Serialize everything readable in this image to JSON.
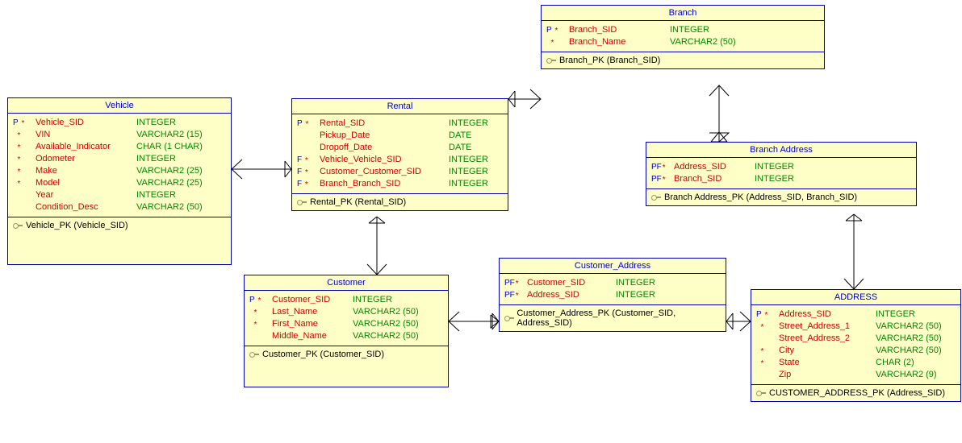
{
  "entities": {
    "vehicle": {
      "title": "Vehicle",
      "columns": [
        {
          "flags": "P*",
          "name": "Vehicle_SID",
          "type": "INTEGER"
        },
        {
          "flags": "*",
          "name": "VIN",
          "type": "VARCHAR2 (15)"
        },
        {
          "flags": "*",
          "name": "Available_Indicator",
          "type": "CHAR (1 CHAR)"
        },
        {
          "flags": "*",
          "name": "Odometer",
          "type": "INTEGER"
        },
        {
          "flags": "*",
          "name": "Make",
          "type": "VARCHAR2 (25)"
        },
        {
          "flags": "*",
          "name": "Model",
          "type": "VARCHAR2 (25)"
        },
        {
          "flags": "",
          "name": "Year",
          "type": "INTEGER"
        },
        {
          "flags": "",
          "name": "Condition_Desc",
          "type": "VARCHAR2 (50)"
        }
      ],
      "pk": "Vehicle_PK (Vehicle_SID)"
    },
    "rental": {
      "title": "Rental",
      "columns": [
        {
          "flags": "P*",
          "name": "Rental_SID",
          "type": "INTEGER"
        },
        {
          "flags": "",
          "name": "Pickup_Date",
          "type": "DATE"
        },
        {
          "flags": "",
          "name": "Dropoff_Date",
          "type": "DATE"
        },
        {
          "flags": "F*",
          "name": "Vehicle_Vehicle_SID",
          "type": "INTEGER"
        },
        {
          "flags": "F*",
          "name": "Customer_Customer_SID",
          "type": "INTEGER"
        },
        {
          "flags": "F*",
          "name": "Branch_Branch_SID",
          "type": "INTEGER"
        }
      ],
      "pk": "Rental_PK (Rental_SID)"
    },
    "branch": {
      "title": "Branch",
      "columns": [
        {
          "flags": "P*",
          "name": "Branch_SID",
          "type": "INTEGER"
        },
        {
          "flags": "*",
          "name": "Branch_Name",
          "type": "VARCHAR2 (50)"
        }
      ],
      "pk": "Branch_PK (Branch_SID)"
    },
    "branch_address": {
      "title": "Branch Address",
      "columns": [
        {
          "flags": "PF*",
          "name": "Address_SID",
          "type": "INTEGER"
        },
        {
          "flags": "PF*",
          "name": "Branch_SID",
          "type": "INTEGER"
        }
      ],
      "pk": "Branch Address_PK (Address_SID, Branch_SID)"
    },
    "customer": {
      "title": "Customer",
      "columns": [
        {
          "flags": "P*",
          "name": "Customer_SID",
          "type": "INTEGER"
        },
        {
          "flags": "*",
          "name": "Last_Name",
          "type": "VARCHAR2 (50)"
        },
        {
          "flags": "*",
          "name": "First_Name",
          "type": "VARCHAR2 (50)"
        },
        {
          "flags": "",
          "name": "Middle_Name",
          "type": "VARCHAR2 (50)"
        }
      ],
      "pk": "Customer_PK (Customer_SID)"
    },
    "customer_address": {
      "title": "Customer_Address",
      "columns": [
        {
          "flags": "PF*",
          "name": "Customer_SID",
          "type": "INTEGER"
        },
        {
          "flags": "PF*",
          "name": "Address_SID",
          "type": "INTEGER"
        }
      ],
      "pk": "Customer_Address_PK (Customer_SID, Address_SID)"
    },
    "address": {
      "title": "ADDRESS",
      "columns": [
        {
          "flags": "P*",
          "name": "Address_SID",
          "type": "INTEGER"
        },
        {
          "flags": "*",
          "name": "Street_Address_1",
          "type": "VARCHAR2 (50)"
        },
        {
          "flags": "",
          "name": "Street_Address_2",
          "type": "VARCHAR2 (50)"
        },
        {
          "flags": "*",
          "name": "City",
          "type": "VARCHAR2 (50)"
        },
        {
          "flags": "*",
          "name": "State",
          "type": "CHAR (2)"
        },
        {
          "flags": "",
          "name": "Zip",
          "type": "VARCHAR2 (9)"
        }
      ],
      "pk": "CUSTOMER_ADDRESS_PK (Address_SID)"
    }
  }
}
